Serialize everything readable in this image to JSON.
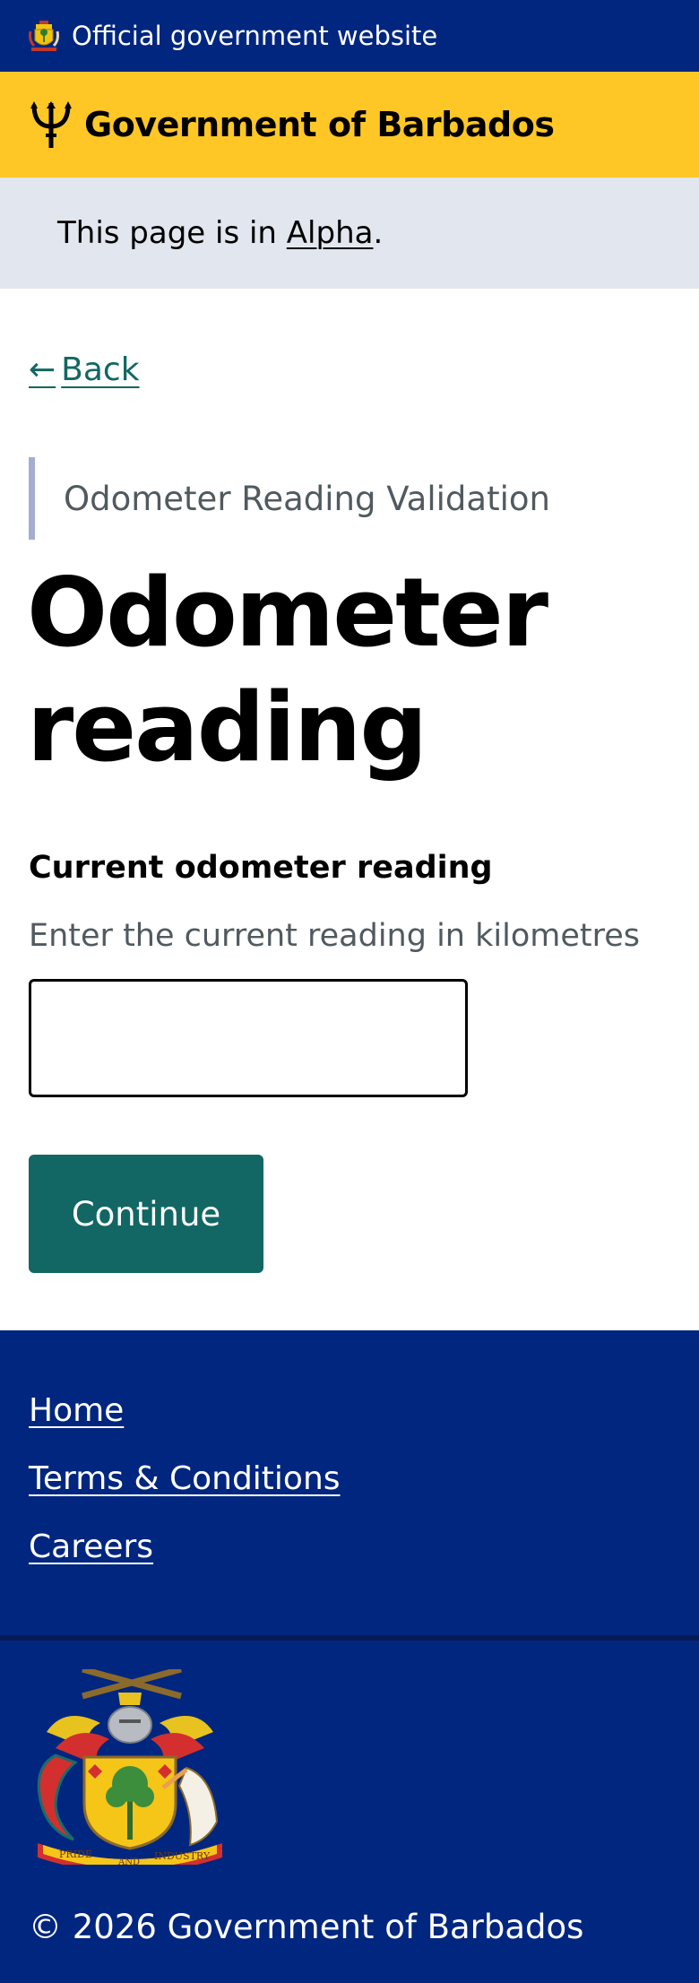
{
  "header": {
    "official_text": "Official government website",
    "brand_title": "Government of Barbados"
  },
  "phase_banner": {
    "prefix": "This page is in ",
    "phase_link": "Alpha",
    "suffix": "."
  },
  "back_link": {
    "arrow": "←",
    "label": "Back"
  },
  "caption": "Odometer Reading Validation",
  "page_title": "Odometer reading",
  "form": {
    "label": "Current odometer reading",
    "hint": "Enter the current reading in kilometres",
    "value": "",
    "submit_label": "Continue"
  },
  "footer": {
    "links": [
      "Home",
      "Terms & Conditions",
      "Careers"
    ],
    "crest_motto_left": "PRIDE",
    "crest_motto_middle": "AND",
    "crest_motto_right": "INDUSTRY",
    "copyright": "© 2026 Government of Barbados"
  },
  "colors": {
    "navy": "#00267f",
    "gold": "#ffc726",
    "teal": "#126764",
    "phase_bg": "#e2e6ee",
    "caption_border": "#a3aed0"
  },
  "icons": [
    "coat-of-arms-icon",
    "trident-icon",
    "back-arrow-icon"
  ]
}
